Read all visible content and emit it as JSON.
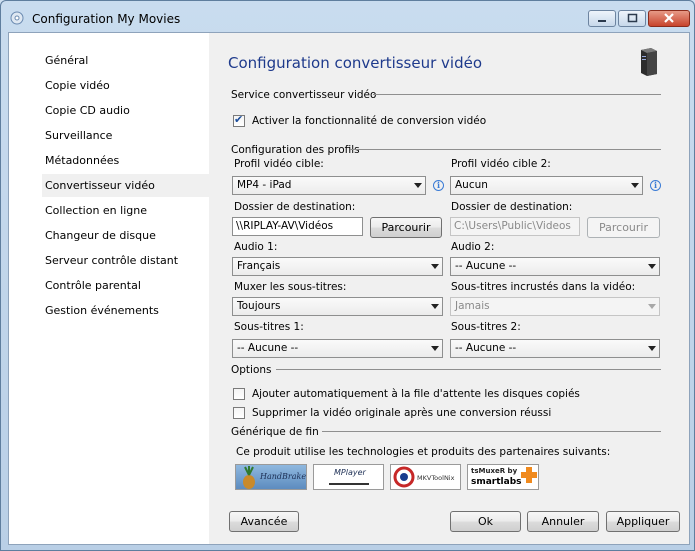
{
  "window": {
    "title": "Configuration My Movies"
  },
  "sidebar": {
    "items": [
      {
        "label": "Général"
      },
      {
        "label": "Copie vidéo"
      },
      {
        "label": "Copie CD audio"
      },
      {
        "label": "Surveillance"
      },
      {
        "label": "Métadonnées"
      },
      {
        "label": "Convertisseur vidéo",
        "selected": true
      },
      {
        "label": "Collection en ligne"
      },
      {
        "label": "Changeur de disque"
      },
      {
        "label": "Serveur contrôle distant"
      },
      {
        "label": "Contrôle parental"
      },
      {
        "label": "Gestion événements"
      }
    ]
  },
  "main": {
    "title": "Configuration convertisseur vidéo",
    "service": {
      "heading": "Service convertisseur vidéo",
      "enable_label": "Activer la fonctionnalité de conversion vidéo",
      "enable_checked": true
    },
    "profiles": {
      "heading": "Configuration des profils",
      "profile1": {
        "label": "Profil vidéo cible:",
        "value": "MP4 - iPad"
      },
      "profile2": {
        "label": "Profil vidéo cible 2:",
        "value": "Aucun"
      },
      "dest1": {
        "label": "Dossier de destination:",
        "value": "\\\\RIPLAY-AV\\Vidéos",
        "browse": "Parcourir"
      },
      "dest2": {
        "label": "Dossier de destination:",
        "value": "C:\\Users\\Public\\Videos",
        "browse": "Parcourir"
      },
      "audio1": {
        "label": "Audio 1:",
        "value": "Français"
      },
      "audio2": {
        "label": "Audio 2:",
        "value": "-- Aucune --"
      },
      "mux_subs": {
        "label": "Muxer les sous-titres:",
        "value": "Toujours"
      },
      "burn_subs": {
        "label": "Sous-titres incrustés dans la vidéo:",
        "value": "Jamais"
      },
      "subs1": {
        "label": "Sous-titres 1:",
        "value": "-- Aucune --"
      },
      "subs2": {
        "label": "Sous-titres 2:",
        "value": "-- Aucune --"
      }
    },
    "options": {
      "heading": "Options",
      "queue_label": "Ajouter automatiquement à la file d'attente les disques copiés",
      "queue_checked": false,
      "delete_label": "Supprimer la vidéo originale après une conversion réussi",
      "delete_checked": false
    },
    "credits": {
      "heading": "Générique de fin",
      "text": "Ce produit utilise les technologies et produits des partenaires suivants:",
      "logos": [
        {
          "name": "handbrake-logo",
          "text": "HandBrake"
        },
        {
          "name": "mplayer-logo",
          "text": "MPlayer"
        },
        {
          "name": "mkvtoolnix-logo",
          "text": "MKVToolNix"
        },
        {
          "name": "tsmuxer-logo",
          "text_top": "tsMuxeR by",
          "text_bottom": "smartlabs"
        }
      ]
    }
  },
  "footer": {
    "advanced": "Avancée",
    "ok": "Ok",
    "cancel": "Annuler",
    "apply": "Appliquer"
  },
  "icons": {
    "info": "i"
  }
}
